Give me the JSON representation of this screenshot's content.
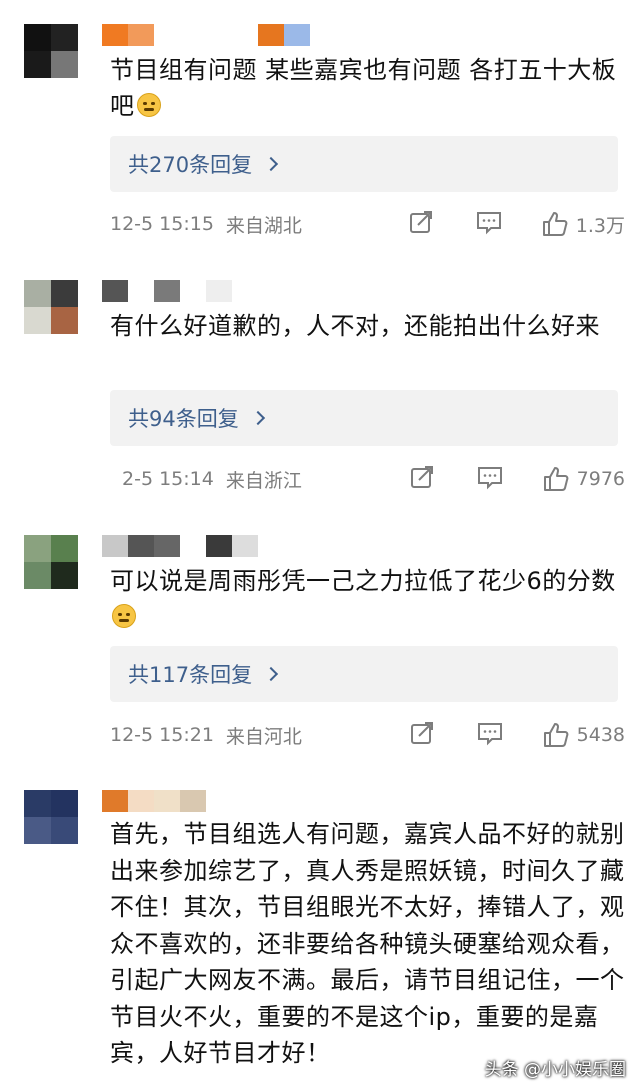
{
  "comments": [
    {
      "text": "节目组有问题 某些嘉宾也有问题 各打五十大板吧",
      "replies_label": "共270条回复",
      "time": "12-5 15:15",
      "location": "来自湖北",
      "likes": "1.3万",
      "avatar_colors": [
        "#111111",
        "#222222",
        "#1a1a1a",
        "#777777"
      ],
      "name_colors": [
        "#f07a22",
        "#f29a5a",
        "#ffffff",
        "#ffffff",
        "#ffffff",
        "#ffffff",
        "#e6761f",
        "#9bb9e8"
      ]
    },
    {
      "text": "有什么好道歉的，人不对，还能拍出什么好来",
      "replies_label": "共94条回复",
      "time": "2-5 15:14",
      "location": "来自浙江",
      "likes": "7976",
      "avatar_colors": [
        "#a9afa3",
        "#3b3b3b",
        "#d9d9d0",
        "#a86443"
      ],
      "name_colors": [
        "#555555",
        "#ffffff",
        "#7a7a7a",
        "#ffffff",
        "#eeeeee"
      ]
    },
    {
      "text": "可以说是周雨彤凭一己之力拉低了花少6的分数",
      "replies_label": "共117条回复",
      "time": "12-5 15:21",
      "location": "来自河北",
      "likes": "5438",
      "avatar_colors": [
        "#8aa27f",
        "#59804e",
        "#6b8a66",
        "#1f2a1d"
      ],
      "name_colors": [
        "#c8c8c8",
        "#555555",
        "#666666",
        "#ffffff",
        "#3a3a3a",
        "#dddddd"
      ]
    },
    {
      "text": "首先，节目组选人有问题，嘉宾人品不好的就别出来参加综艺了，真人秀是照妖镜，时间久了藏不住！其次，节目组眼光不太好，捧错人了，观众不喜欢的，还非要给各种镜头硬塞给观众看，引起广大网友不满。最后，请节目组记住，一个节目火不火，重要的不是这个ip，重要的是嘉宾，人好节目才好！",
      "avatar_colors": [
        "#2a3b66",
        "#233360",
        "#4a5a86",
        "#394a78"
      ],
      "name_colors": [
        "#e07a2a",
        "#f4dcc4",
        "#f0e0c8",
        "#d9c8b0"
      ]
    }
  ],
  "watermark": "头条 @小小娱乐圈",
  "colors": {
    "link": "#3e5f8c",
    "meta_text": "#7d7d7d",
    "reply_bg": "#f2f2f2"
  },
  "icons": [
    "share-icon",
    "comment-icon",
    "like-icon",
    "chevron-right-icon"
  ]
}
